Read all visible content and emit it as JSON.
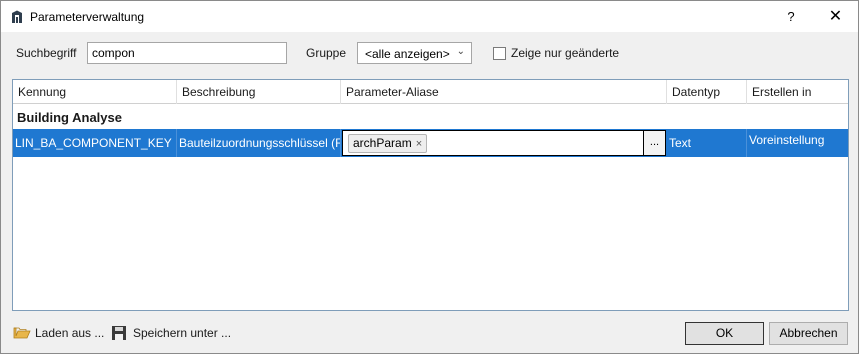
{
  "window": {
    "title": "Parameterverwaltung",
    "help_label": "?",
    "close_label": "✕"
  },
  "filters": {
    "search_label": "Suchbegriff",
    "search_value": "compon",
    "group_label": "Gruppe",
    "group_value": "<alle anzeigen>",
    "changed_only_label": "Zeige nur geänderte",
    "changed_only_checked": false
  },
  "table": {
    "columns": [
      "Kennung",
      "Beschreibung",
      "Parameter-Aliase",
      "Datentyp",
      "Erstellen in"
    ],
    "groups": [
      {
        "name": "Building Analyse",
        "rows": [
          {
            "id": "LIN_BA_COMPONENT_KEY",
            "description": "Bauteilzuordnungsschlüssel (R",
            "aliases": [
              "archParam"
            ],
            "alias_remove": "×",
            "alias_edit": "...",
            "datatype": "Text",
            "create_in": "Voreinstellung",
            "selected": true
          }
        ]
      }
    ]
  },
  "footer": {
    "load_label": "Laden aus ...",
    "save_label": "Speichern unter ...",
    "ok_label": "OK",
    "cancel_label": "Abbrechen"
  },
  "colors": {
    "selection": "#1f78d1",
    "dialog_bg": "#f0f0f0",
    "folder": "#e8b64a"
  }
}
